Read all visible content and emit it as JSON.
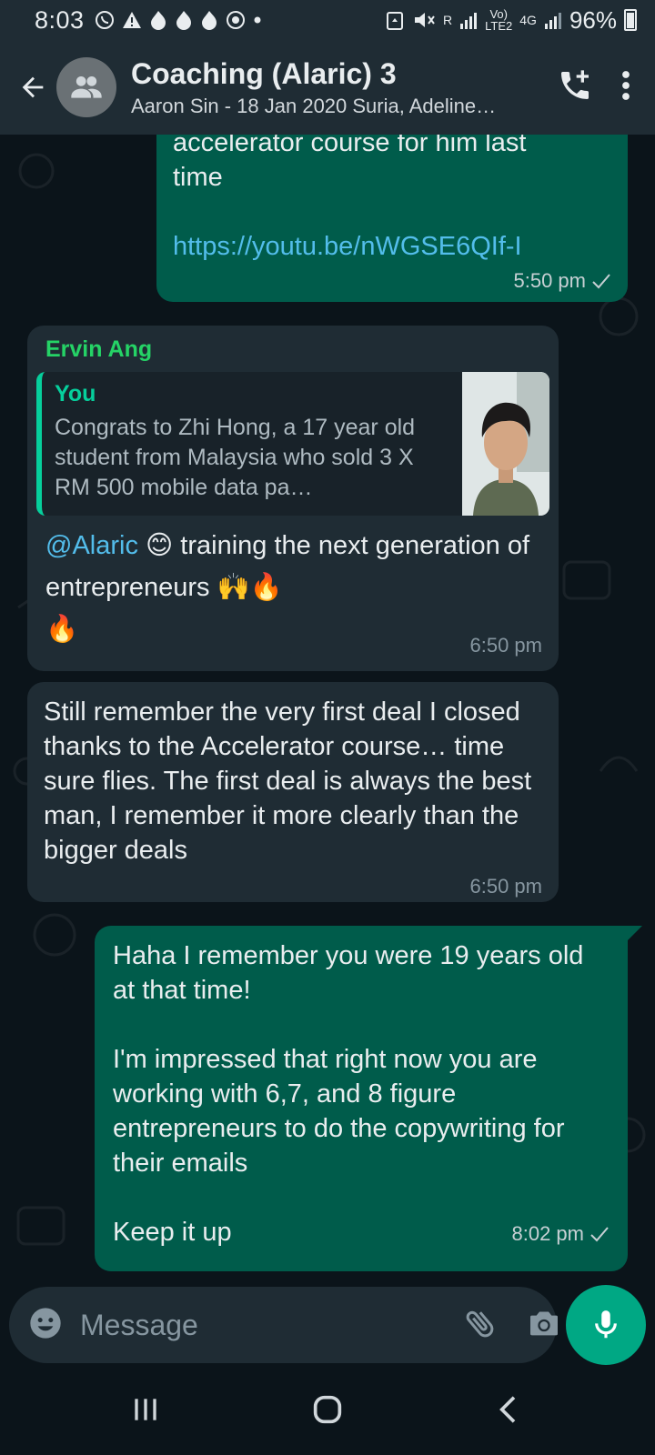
{
  "status_bar": {
    "time": "8:03",
    "battery": "96%",
    "volte": "Vo)\nLTE2",
    "network": "4G",
    "sim": "R"
  },
  "header": {
    "title": "Coaching (Alaric) 3",
    "subtitle": "Aaron Sin - 18 Jan 2020 Suria, Adeline…"
  },
  "messages": [
    {
      "direction": "out",
      "text_partial": "accelerator course for him last\ntime",
      "link": "https://youtu.be/nWGSE6QIf-I",
      "time": "5:50 pm"
    },
    {
      "direction": "in",
      "sender": "Ervin Ang",
      "quote_author": "You",
      "quote_text": "Congrats to Zhi Hong, a 17 year old student from Malaysia who sold 3 X RM 500 mobile data pa…",
      "mention": "@Alaric",
      "emoji_1": "😊",
      "text": " training the next generation of entrepreneurs ",
      "emoji_2": "🙌🔥",
      "emoji_3": "🔥",
      "time": "6:50 pm"
    },
    {
      "direction": "in",
      "text": "Still remember the very first deal I closed thanks to the Accelerator course… time sure flies. The first deal is always the best man, I remember it more clearly than the bigger deals",
      "time": "6:50 pm"
    },
    {
      "direction": "out",
      "text": "Haha I remember you were 19 years old at that time!\n\nI'm impressed that right now you are working with 6,7, and 8 figure entrepreneurs to do the copywriting for their emails\n\nKeep it up",
      "time": "8:02 pm"
    }
  ],
  "input": {
    "placeholder": "Message"
  },
  "colors": {
    "background": "#0b141a",
    "header": "#1f2c34",
    "outgoing": "#005c4b",
    "incoming": "#1f2c34",
    "accent": "#00a884",
    "link": "#53bdeb"
  }
}
